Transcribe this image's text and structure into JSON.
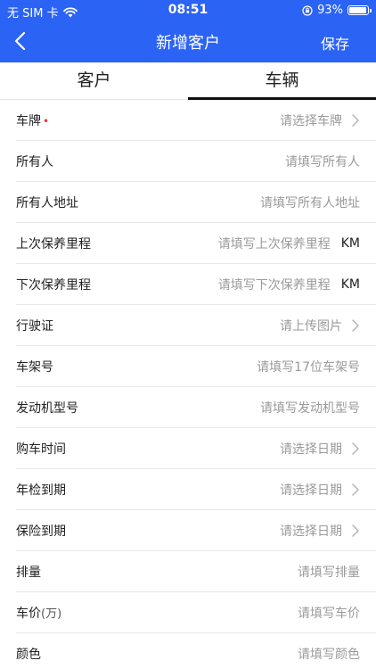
{
  "status_bar": {
    "carrier": "无 SIM 卡",
    "time": "08:51",
    "battery": "93%"
  },
  "header": {
    "title": "新增客户",
    "save_label": "保存",
    "bg": "#2b63f5"
  },
  "tabs": [
    {
      "label": "客户",
      "active": false
    },
    {
      "label": "车辆",
      "active": true
    }
  ],
  "form": [
    {
      "label": "车牌",
      "required": true,
      "required_mark": "•",
      "placeholder": "请选择车牌",
      "chevron": true
    },
    {
      "label": "所有人",
      "placeholder": "请填写所有人"
    },
    {
      "label": "所有人地址",
      "placeholder": "请填写所有人地址"
    },
    {
      "label": "上次保养里程",
      "placeholder": "请填写上次保养里程",
      "unit": "KM"
    },
    {
      "label": "下次保养里程",
      "placeholder": "请填写下次保养里程",
      "unit": "KM"
    },
    {
      "label": "行驶证",
      "placeholder": "请上传图片",
      "chevron": true
    },
    {
      "label": "车架号",
      "placeholder": "请填写17位车架号"
    },
    {
      "label": "发动机型号",
      "placeholder": "请填写发动机型号"
    },
    {
      "label": "购车时间",
      "placeholder": "请选择日期",
      "chevron": true
    },
    {
      "label": "年检到期",
      "placeholder": "请选择日期",
      "chevron": true
    },
    {
      "label": "保险到期",
      "placeholder": "请选择日期",
      "chevron": true
    },
    {
      "label": "排量",
      "placeholder": "请填写排量"
    },
    {
      "label": "车价",
      "suffix": "(万)",
      "placeholder": "请填写车价"
    },
    {
      "label": "颜色",
      "placeholder": "请填写颜色"
    }
  ]
}
